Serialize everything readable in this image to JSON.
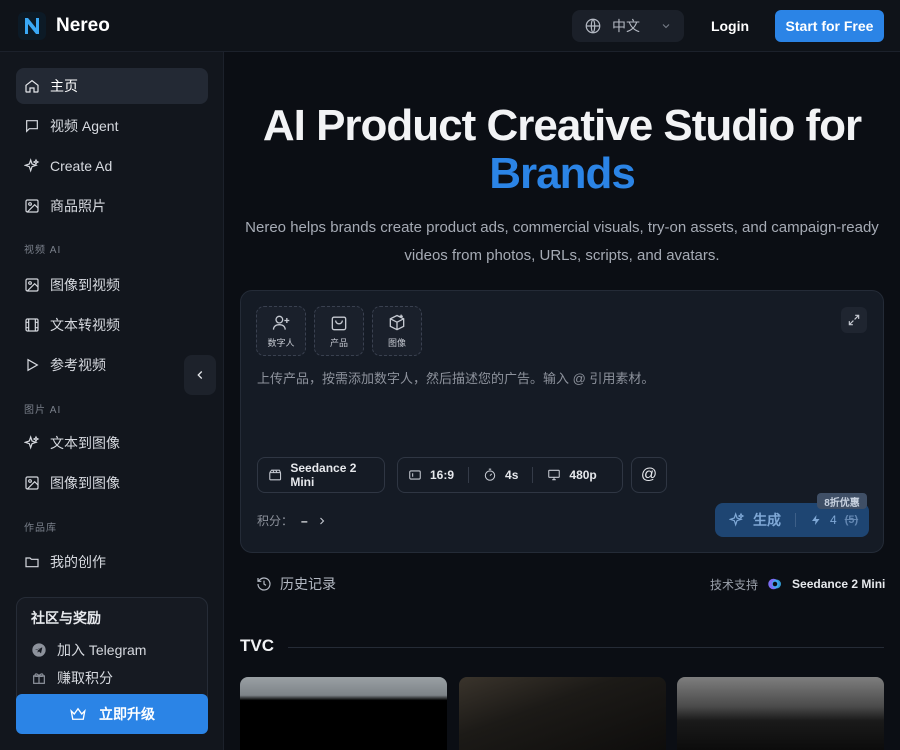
{
  "header": {
    "brand": "Nereo",
    "language": "中文",
    "login_label": "Login",
    "start_label": "Start for Free"
  },
  "sidebar": {
    "items": [
      {
        "label": "主页",
        "icon": "home-icon"
      },
      {
        "label": "视频 Agent",
        "icon": "chat-icon"
      },
      {
        "label": "Create Ad",
        "icon": "sparkle-icon"
      },
      {
        "label": "商品照片",
        "icon": "image-icon"
      }
    ],
    "section_video": "视频 AI",
    "video_items": [
      {
        "label": "图像到视频",
        "icon": "image-icon"
      },
      {
        "label": "文本转视频",
        "icon": "film-icon"
      },
      {
        "label": "参考视频",
        "icon": "play-icon"
      }
    ],
    "section_image": "图片 AI",
    "image_items": [
      {
        "label": "文本到图像",
        "icon": "sparkle-icon"
      },
      {
        "label": "图像到图像",
        "icon": "image-icon"
      }
    ],
    "section_library": "作品库",
    "library_items": [
      {
        "label": "我的创作",
        "icon": "folder-icon"
      }
    ],
    "community": {
      "title": "社区与奖励",
      "items": [
        {
          "label": "加入 Telegram",
          "icon": "telegram-icon"
        },
        {
          "label": "赚取积分",
          "icon": "gift-icon"
        }
      ]
    },
    "upgrade_label": "立即升级"
  },
  "hero": {
    "title_line1": "AI Product Creative Studio for",
    "title_line2": "Brands",
    "subtitle": "Nereo helps brands create product ads, commercial visuals, try-on assets, and campaign-ready videos from photos, URLs, scripts, and avatars."
  },
  "composer": {
    "assets": [
      {
        "label": "数字人",
        "icon": "avatar-add-icon"
      },
      {
        "label": "产品",
        "icon": "bag-icon"
      },
      {
        "label": "图像",
        "icon": "box-add-icon"
      }
    ],
    "prompt_placeholder": "上传产品，按需添加数字人，然后描述您的广告。输入 @ 引用素材。",
    "model": "Seedance 2 Mini",
    "ratio": "16:9",
    "duration": "4s",
    "resolution": "480p",
    "mention": "@",
    "credits_label": "积分：",
    "credits_value": "–",
    "generate_label": "生成",
    "cost": "4",
    "original_cost": "(5)",
    "discount_badge": "8折优惠"
  },
  "history_label": "历史记录",
  "powered_by": "技术支持",
  "powered_model": "Seedance 2 Mini",
  "tvc_title": "TVC",
  "colors": {
    "accent": "#2b84e6",
    "background": "#0b0e14",
    "sidebar": "#12161d"
  }
}
